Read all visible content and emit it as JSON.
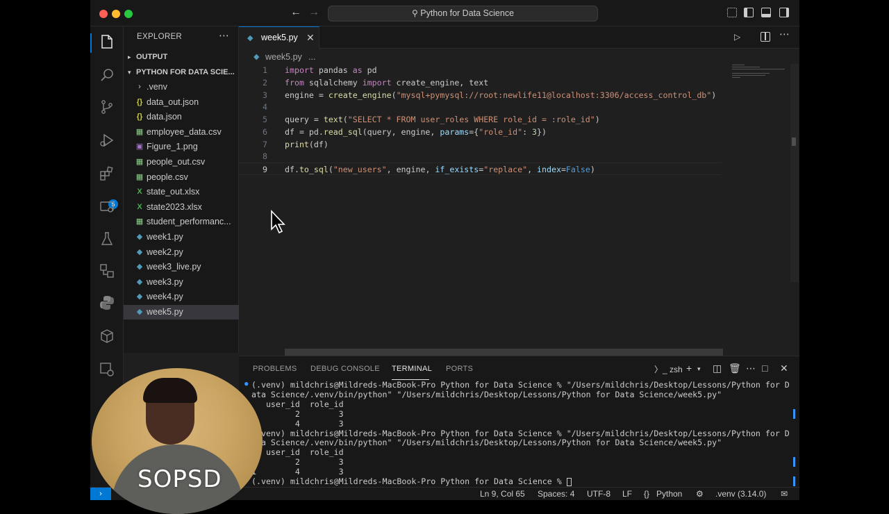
{
  "window": {
    "title": "Python for Data Science"
  },
  "explorer": {
    "title": "EXPLORER",
    "sections": {
      "output": "OUTPUT",
      "project": "PYTHON FOR DATA SCIE..."
    },
    "files": [
      {
        "name": ".venv",
        "type": "folder"
      },
      {
        "name": "data_out.json",
        "type": "json"
      },
      {
        "name": "data.json",
        "type": "json"
      },
      {
        "name": "employee_data.csv",
        "type": "csv"
      },
      {
        "name": "Figure_1.png",
        "type": "png"
      },
      {
        "name": "people_out.csv",
        "type": "csv"
      },
      {
        "name": "people.csv",
        "type": "csv"
      },
      {
        "name": "state_out.xlsx",
        "type": "xlsx"
      },
      {
        "name": "state2023.xlsx",
        "type": "xlsx"
      },
      {
        "name": "student_performanc...",
        "type": "csv"
      },
      {
        "name": "week1.py",
        "type": "py"
      },
      {
        "name": "week2.py",
        "type": "py"
      },
      {
        "name": "week3_live.py",
        "type": "py"
      },
      {
        "name": "week3.py",
        "type": "py"
      },
      {
        "name": "week4.py",
        "type": "py"
      },
      {
        "name": "week5.py",
        "type": "py",
        "selected": true
      }
    ]
  },
  "activity": {
    "extensions_badge": "5"
  },
  "editor": {
    "tab": "week5.py",
    "breadcrumb": {
      "file": "week5.py",
      "sep": "..."
    },
    "line_numbers": [
      "1",
      "2",
      "3",
      "4",
      "5",
      "6",
      "7",
      "8",
      "9"
    ],
    "lines": [
      [
        [
          "kw",
          "import"
        ],
        [
          "plain",
          " pandas "
        ],
        [
          "kw",
          "as"
        ],
        [
          "plain",
          " pd"
        ]
      ],
      [
        [
          "kw",
          "from"
        ],
        [
          "plain",
          " sqlalchemy "
        ],
        [
          "kw",
          "import"
        ],
        [
          "plain",
          " create_engine, text"
        ]
      ],
      [
        [
          "plain",
          "engine = "
        ],
        [
          "fn",
          "create_engine"
        ],
        [
          "plain",
          "("
        ],
        [
          "str",
          "\"mysql+pymysql://root:newlife11@localhost:3306/access_control_db\""
        ],
        [
          "plain",
          ")"
        ]
      ],
      [],
      [
        [
          "plain",
          "query = "
        ],
        [
          "fn",
          "text"
        ],
        [
          "plain",
          "("
        ],
        [
          "str",
          "\"SELECT * FROM user_roles WHERE role_id = :role_id\""
        ],
        [
          "plain",
          ")"
        ]
      ],
      [
        [
          "plain",
          "df = pd."
        ],
        [
          "fn",
          "read_sql"
        ],
        [
          "plain",
          "(query, engine, "
        ],
        [
          "var",
          "params"
        ],
        [
          "plain",
          "={"
        ],
        [
          "str",
          "\"role_id\""
        ],
        [
          "plain",
          ": "
        ],
        [
          "num",
          "3"
        ],
        [
          "plain",
          "})"
        ]
      ],
      [
        [
          "fn",
          "print"
        ],
        [
          "plain",
          "(df)"
        ]
      ],
      [],
      [
        [
          "plain",
          "df."
        ],
        [
          "fn",
          "to_sql"
        ],
        [
          "plain",
          "("
        ],
        [
          "str",
          "\"new_users\""
        ],
        [
          "plain",
          ", engine, "
        ],
        [
          "var",
          "if_exists"
        ],
        [
          "plain",
          "="
        ],
        [
          "str",
          "\"replace\""
        ],
        [
          "plain",
          ", "
        ],
        [
          "var",
          "index"
        ],
        [
          "plain",
          "="
        ],
        [
          "bool",
          "False"
        ],
        [
          "plain",
          ")"
        ]
      ]
    ],
    "current_line": 9
  },
  "panel": {
    "tabs": [
      "PROBLEMS",
      "DEBUG CONSOLE",
      "TERMINAL",
      "PORTS"
    ],
    "active_tab": "TERMINAL",
    "shell": "zsh",
    "terminal_lines": [
      "(.venv) mildchris@Mildreds-MacBook-Pro Python for Data Science % \"/Users/mildchris/Desktop/Lessons/Python for D",
      "ata Science/.venv/bin/python\" \"/Users/mildchris/Desktop/Lessons/Python for Data Science/week5.py\"",
      "   user_id  role_id",
      "0        2        3",
      "1        4        3",
      "(.venv) mildchris@Mildreds-MacBook-Pro Python for Data Science % \"/Users/mildchris/Desktop/Lessons/Python for D",
      "ata Science/.venv/bin/python\" \"/Users/mildchris/Desktop/Lessons/Python for Data Science/week5.py\"",
      "   user_id  role_id",
      "0        2        3",
      "1        4        3",
      "(.venv) mildchris@Mildreds-MacBook-Pro Python for Data Science % "
    ]
  },
  "statusbar": {
    "position": "Ln 9, Col 65",
    "spaces": "Spaces: 4",
    "encoding": "UTF-8",
    "eol": "LF",
    "language": "Python",
    "interpreter": ".venv (3.14.0)"
  },
  "webcam": {
    "label": "SOPSD"
  },
  "colors": {
    "accent": "#0078d4",
    "background": "#1f1f1f",
    "sidebar": "#181818"
  }
}
